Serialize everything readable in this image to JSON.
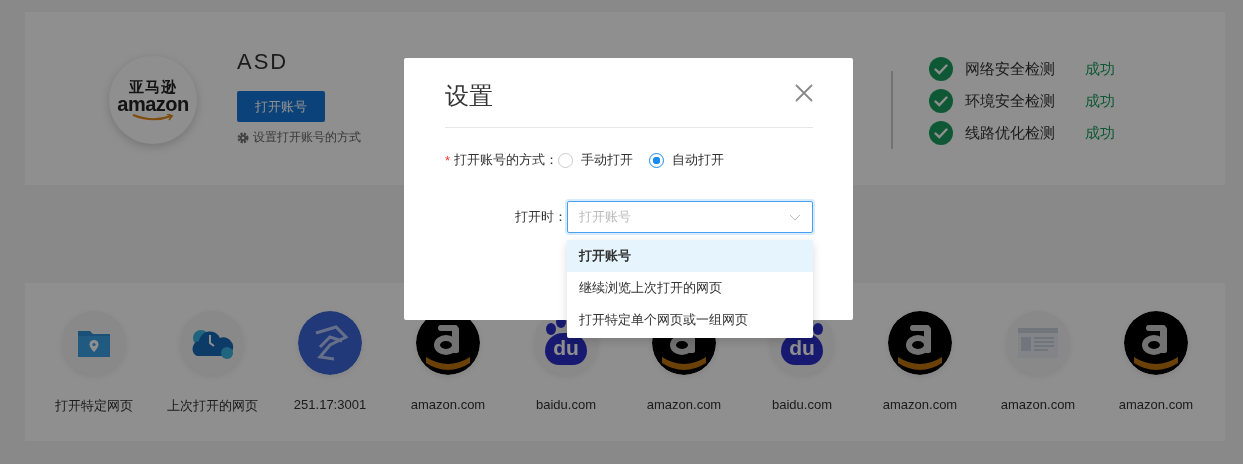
{
  "account": {
    "logo_text": [
      "亚马逊",
      "amazon"
    ],
    "name": "ASD",
    "open_button": "打开账号",
    "settings_link": "设置打开账号的方式"
  },
  "checks": [
    {
      "label": "网络安全检测",
      "status": "成功",
      "passed": true
    },
    {
      "label": "环境安全检测",
      "status": "成功",
      "passed": true
    },
    {
      "label": "线路优化检测",
      "status": "成功",
      "passed": true
    }
  ],
  "shortcuts": [
    {
      "label": "打开特定网页",
      "kind": "folder"
    },
    {
      "label": "上次打开的网页",
      "kind": "cloud"
    },
    {
      "label": "251.17:3001",
      "kind": "site"
    },
    {
      "label": "amazon.com",
      "kind": "amazon"
    },
    {
      "label": "baidu.com",
      "kind": "baidu",
      "glyph": "du"
    },
    {
      "label": "amazon.com",
      "kind": "amazon"
    },
    {
      "label": "baidu.com",
      "kind": "baidu",
      "glyph": "du"
    },
    {
      "label": "amazon.com",
      "kind": "amazon"
    },
    {
      "label": "amazon.com",
      "kind": "webpage"
    },
    {
      "label": "amazon.com",
      "kind": "amazon"
    }
  ],
  "dialog": {
    "title": "设置",
    "method": {
      "label": "打开账号的方式：",
      "required_mark": "*",
      "options": [
        {
          "label": "手动打开",
          "selected": false
        },
        {
          "label": "自动打开",
          "selected": true
        }
      ]
    },
    "open_when": {
      "label": "打开时：",
      "placeholder": "打开账号",
      "expanded": true,
      "items": [
        {
          "label": "打开账号",
          "selected": true
        },
        {
          "label": "继续浏览上次打开的网页",
          "selected": false
        },
        {
          "label": "打开特定单个网页或一组网页",
          "selected": false
        }
      ]
    }
  }
}
